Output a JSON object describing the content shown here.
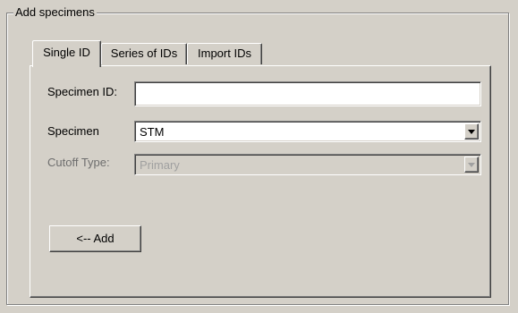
{
  "group": {
    "title": "Add specimens"
  },
  "tabs": [
    {
      "label": "Single ID",
      "active": true
    },
    {
      "label": "Series of IDs",
      "active": false
    },
    {
      "label": "Import IDs",
      "active": false
    }
  ],
  "form": {
    "specimen_id": {
      "label": "Specimen ID:",
      "value": "",
      "placeholder": ""
    },
    "specimen": {
      "label": "Specimen",
      "selected": "STM"
    },
    "cutoff_type": {
      "label": "Cutoff Type:",
      "selected": "Primary",
      "enabled": false
    }
  },
  "add_button": {
    "label": "<-- Add"
  },
  "colors": {
    "face": "#d4d0c8",
    "field": "#ffffff",
    "disabled_text": "#a0a0a0"
  },
  "icons": {
    "dropdown": "chevron-down-icon"
  }
}
